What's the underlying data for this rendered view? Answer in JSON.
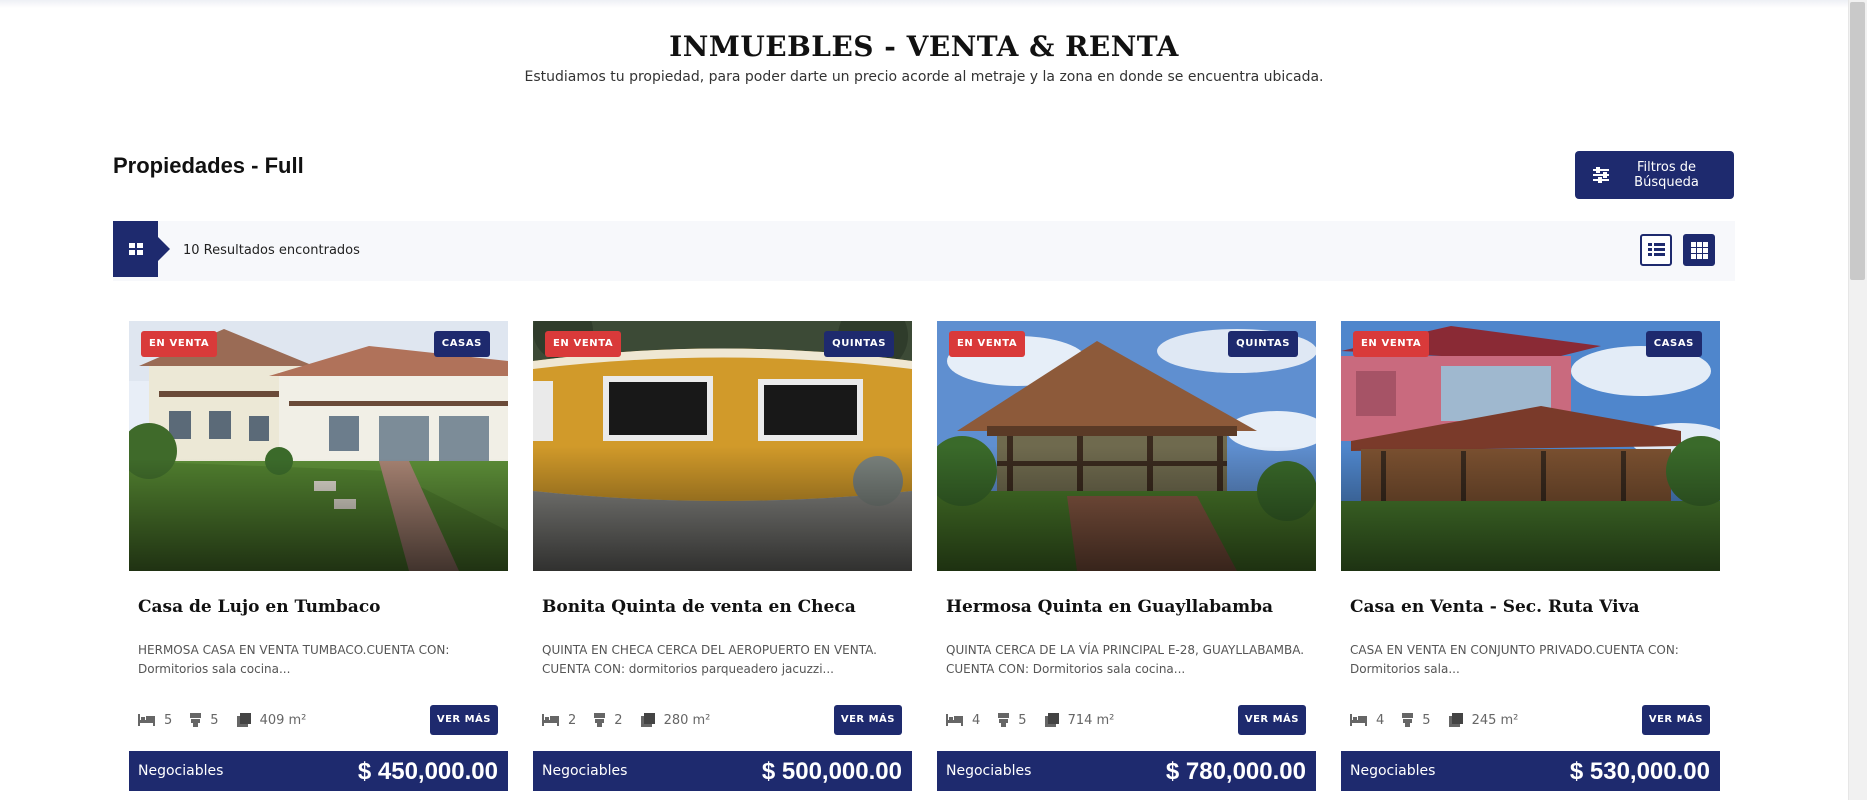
{
  "hero": {
    "title": "INMUEBLES - VENTA & RENTA",
    "subtitle": "Estudiamos tu propiedad, para poder darte un precio acorde al metraje y la zona en donde se encuentra ubicada."
  },
  "section": {
    "title": "Propiedades - Full",
    "filter_button": "Filtros de Búsqueda"
  },
  "results": {
    "count_text": "10 Resultados encontrados"
  },
  "colors": {
    "brand": "#1e2a6e",
    "sale_tag": "#d93a3a"
  },
  "cards": [
    {
      "sale_tag": "EN VENTA",
      "type_tag": "CASAS",
      "title": "Casa de Lujo en Tumbaco",
      "desc": "HERMOSA CASA EN VENTA TUMBACO.CUENTA CON: Dormitorios sala cocina...",
      "beds": "5",
      "baths": "5",
      "area": "409 m²",
      "cta": "VER MÁS",
      "price_label": "Negociables",
      "price": "$ 450,000.00"
    },
    {
      "sale_tag": "EN VENTA",
      "type_tag": "QUINTAS",
      "title": "Bonita Quinta de venta en Checa",
      "desc": "QUINTA EN CHECA CERCA DEL AEROPUERTO EN VENTA. CUENTA CON: dormitorios parqueadero jacuzzi...",
      "beds": "2",
      "baths": "2",
      "area": "280 m²",
      "cta": "VER MÁS",
      "price_label": "Negociables",
      "price": "$ 500,000.00"
    },
    {
      "sale_tag": "EN VENTA",
      "type_tag": "QUINTAS",
      "title": "Hermosa Quinta en Guayllabamba",
      "desc": "QUINTA CERCA DE LA VÍA PRINCIPAL E-28, GUAYLLABAMBA. CUENTA CON: Dormitorios sala cocina...",
      "beds": "4",
      "baths": "5",
      "area": "714 m²",
      "cta": "VER MÁS",
      "price_label": "Negociables",
      "price": "$ 780,000.00"
    },
    {
      "sale_tag": "EN VENTA",
      "type_tag": "CASAS",
      "title": "Casa en Venta - Sec. Ruta Viva",
      "desc": "CASA EN VENTA EN CONJUNTO PRIVADO.CUENTA CON: Dormitorios sala...",
      "beds": "4",
      "baths": "5",
      "area": "245 m²",
      "cta": "VER MÁS",
      "price_label": "Negociables",
      "price": "$ 530,000.00"
    }
  ]
}
